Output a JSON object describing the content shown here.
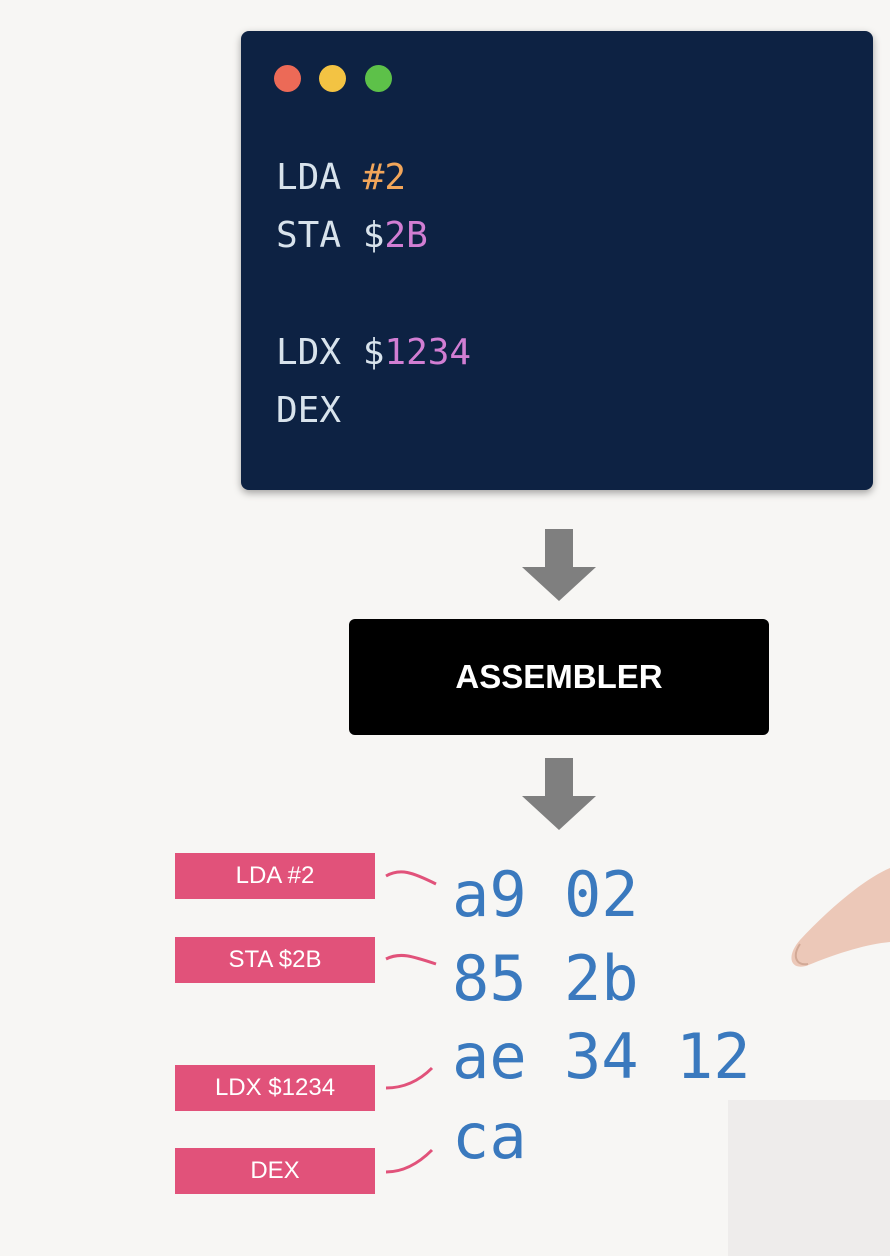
{
  "editor": {
    "lines": [
      {
        "op": "LDA ",
        "arg_prefix": "",
        "arg": "#2",
        "arg_color": "#f2a65a"
      },
      {
        "op": "STA ",
        "arg_prefix": "$",
        "arg": "2B",
        "arg_color": "#d17ed3"
      },
      {
        "op": "LDX ",
        "arg_prefix": "$",
        "arg": "1234",
        "arg_color": "#d17ed3"
      },
      {
        "op": "DEX",
        "arg_prefix": "",
        "arg": "",
        "arg_color": "#d17ed3"
      }
    ]
  },
  "assembler": {
    "label": "ASSEMBLER"
  },
  "tags": [
    "LDA #2",
    "STA $2B",
    "LDX $1234",
    "DEX"
  ],
  "machine_code": [
    "a9 02",
    "85 2b",
    "ae 34 12",
    "ca"
  ],
  "colors": {
    "editor_bg": "#0d2243",
    "tag_bg": "#e1527a",
    "bytes": "#3a79be",
    "arrow": "#7f7f7f"
  }
}
